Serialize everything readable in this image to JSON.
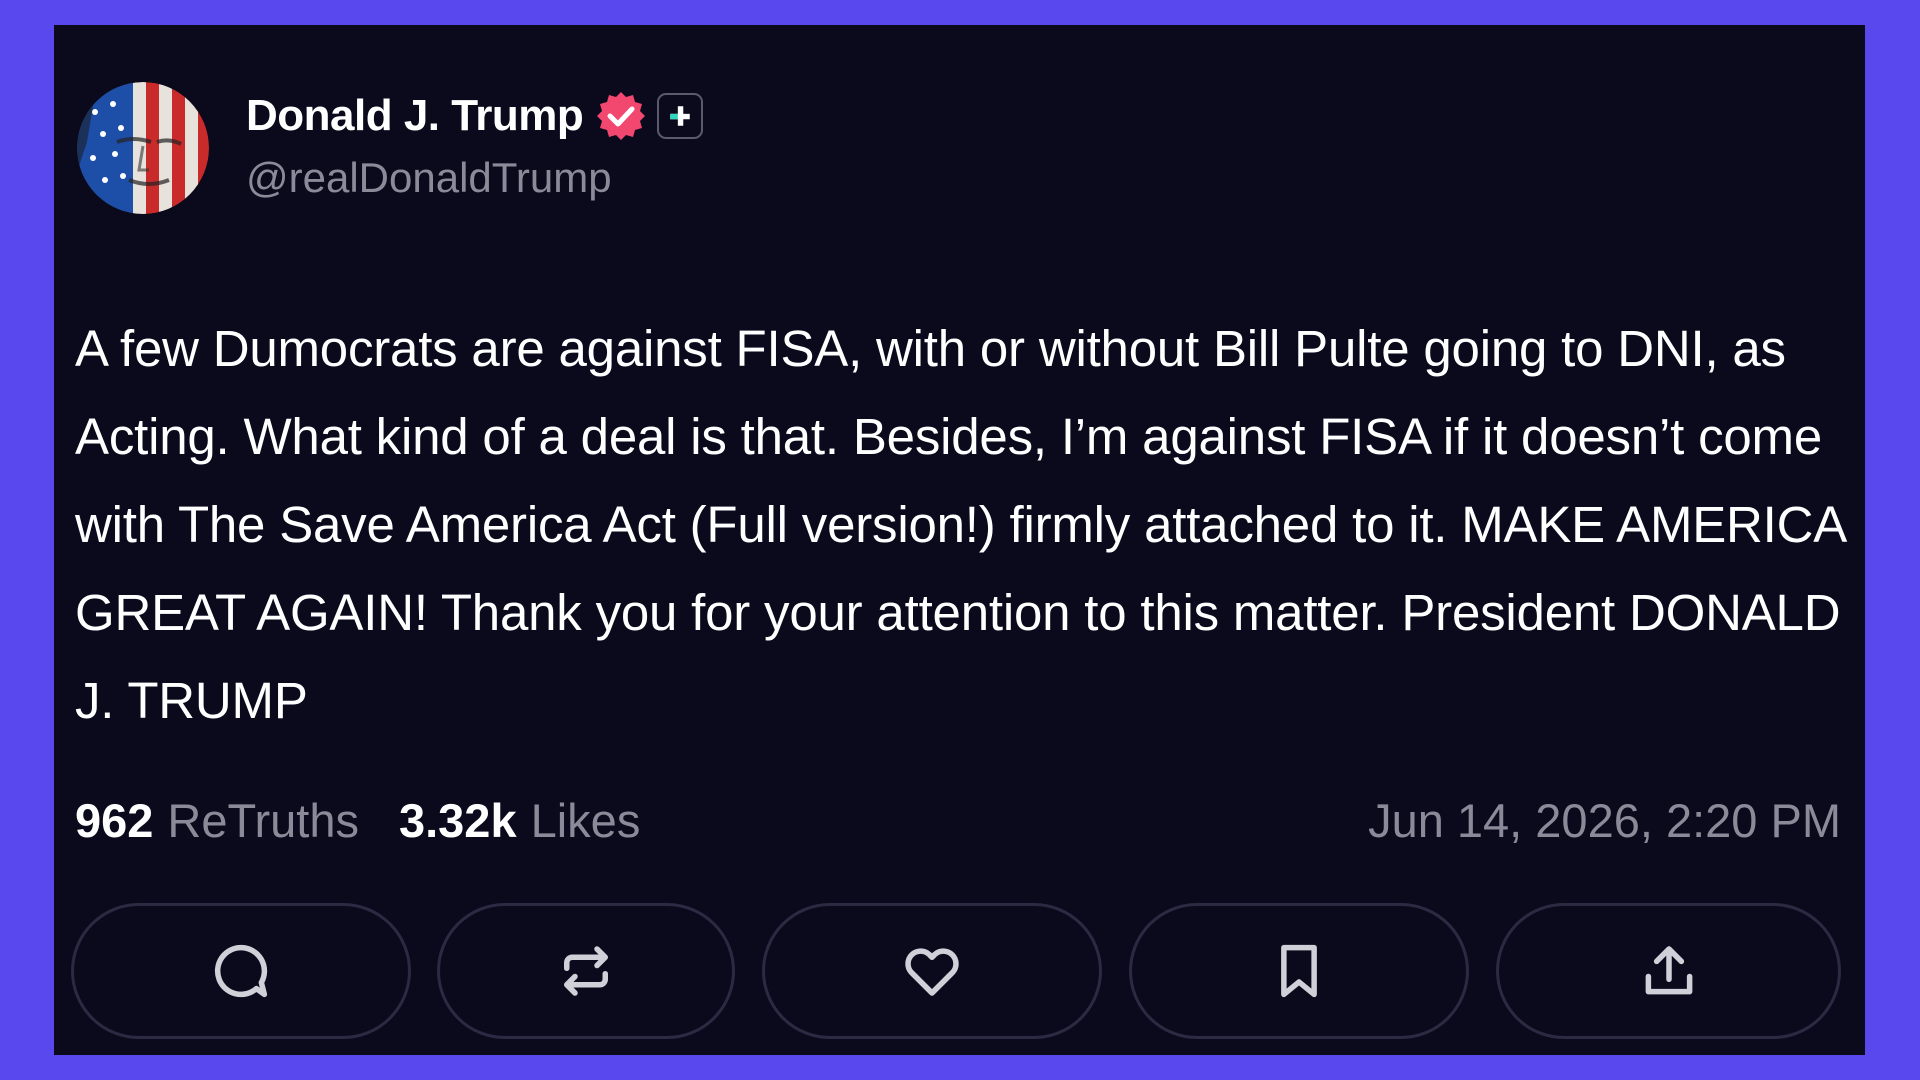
{
  "post": {
    "author": {
      "display_name": "Donald J. Trump",
      "handle": "@realDonaldTrump",
      "verified": true
    },
    "text": "A few Dumocrats are against FISA, with or without Bill Pulte going to DNI, as Acting. What kind of a deal is that. Besides, I’m against FISA if it doesn’t come with The Save America Act (Full version!) firmly attached to it. MAKE AMERICA GREAT AGAIN! Thank you for your attention to this matter. President DONALD J. TRUMP",
    "stats": {
      "retruths_count": "962",
      "retruths_label": "ReTruths",
      "likes_count": "3.32k",
      "likes_label": "Likes"
    },
    "timestamp": "Jun 14, 2026, 2:20 PM"
  },
  "actions": [
    {
      "name": "reply",
      "icon": "comment-icon"
    },
    {
      "name": "retruth",
      "icon": "repost-icon"
    },
    {
      "name": "like",
      "icon": "heart-icon"
    },
    {
      "name": "bookmark",
      "icon": "bookmark-icon"
    },
    {
      "name": "share",
      "icon": "share-icon"
    }
  ],
  "colors": {
    "background": "#5a48ef",
    "card": "#0b0a1d",
    "text_primary": "#ffffff",
    "text_secondary": "#8a8a98",
    "verified_badge": "#f2476f",
    "button_border": "#2b2a42"
  }
}
